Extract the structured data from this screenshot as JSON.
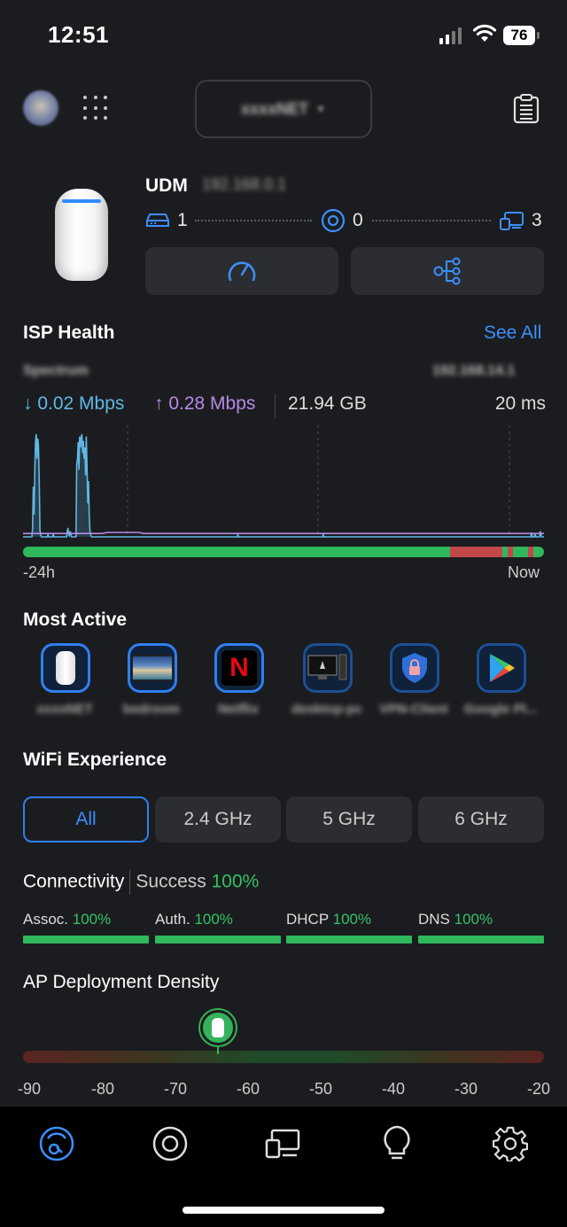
{
  "status_bar": {
    "time": "12:51",
    "battery": "76"
  },
  "header": {
    "site_name": "xxxxNET",
    "avatar": "user-avatar"
  },
  "device": {
    "name": "UDM",
    "ip": "192.168.0.1",
    "wired_count": "1",
    "wireless_count": "0",
    "clients_count": "3"
  },
  "isp_health": {
    "title": "ISP Health",
    "see_all": "See All",
    "isp_name": "Spectrum",
    "isp_ip": "192.168.14.1",
    "download": "0.02 Mbps",
    "upload": "0.28 Mbps",
    "total": "21.94 GB",
    "latency": "20 ms",
    "range_start": "-24h",
    "range_end": "Now"
  },
  "chart_data": {
    "type": "area",
    "title": "",
    "x_labels": [
      "-24h",
      "Now"
    ],
    "series": [
      {
        "values": [
          0,
          0,
          0,
          0,
          0,
          0,
          0,
          0,
          0,
          0,
          0,
          0,
          0,
          8,
          45,
          20,
          60,
          85,
          92,
          70,
          88,
          82,
          50,
          6,
          2,
          0,
          0,
          0,
          0,
          0,
          0,
          0,
          0,
          0,
          2,
          0,
          0,
          0,
          0,
          0,
          0,
          3,
          0,
          0,
          0,
          0,
          0,
          0,
          0,
          0,
          0,
          0,
          0,
          0,
          0,
          0,
          0,
          0,
          0,
          0,
          4,
          8,
          2,
          1,
          5,
          3,
          0,
          0,
          0,
          0,
          0,
          0,
          0,
          65,
          70,
          85,
          60,
          90,
          80,
          88,
          92,
          75,
          86,
          70,
          80,
          55,
          90,
          60,
          30,
          50,
          20,
          5,
          2,
          0,
          0,
          0,
          0,
          0,
          0,
          0,
          0,
          0,
          0,
          0,
          0,
          0,
          0,
          0,
          0,
          0,
          0,
          0,
          0,
          0,
          0,
          0,
          0,
          0,
          0,
          0,
          0,
          0,
          0,
          0,
          0,
          0,
          0,
          0,
          0,
          0,
          0,
          0,
          0,
          0,
          0,
          0,
          0,
          0,
          0,
          0,
          0,
          0,
          0,
          0,
          0,
          0,
          0,
          0,
          0,
          0,
          0,
          0,
          0,
          0,
          0,
          0,
          0,
          0,
          0,
          0,
          0,
          0,
          0,
          0,
          0,
          0,
          0,
          0,
          0,
          0,
          0,
          0,
          0,
          0,
          0,
          0,
          0,
          0,
          0,
          0,
          0,
          0,
          0,
          0,
          0,
          0,
          0,
          0,
          0,
          0,
          0,
          0,
          0,
          0,
          0,
          0,
          0,
          0,
          0,
          0,
          0,
          0,
          0,
          0,
          0,
          0,
          0,
          0,
          0,
          0,
          0,
          0,
          0,
          0,
          0,
          0,
          0,
          0,
          0,
          0,
          0,
          0,
          0,
          0,
          0,
          0,
          0,
          0,
          0,
          0,
          0,
          0,
          0,
          0,
          0,
          0,
          0,
          0,
          0,
          0,
          0,
          0,
          0,
          0,
          0,
          0,
          0,
          0,
          0,
          0,
          0,
          0,
          0,
          0,
          0,
          0,
          0,
          0,
          0,
          0,
          0,
          0,
          0,
          0,
          0,
          0,
          0,
          0,
          0,
          0,
          0,
          0,
          0,
          0,
          0,
          0,
          0,
          0,
          0,
          0,
          0,
          0,
          0,
          0,
          0,
          0,
          0,
          0,
          0,
          0,
          0,
          0,
          2,
          0,
          0,
          0,
          0,
          0,
          0,
          0,
          0,
          0,
          0,
          0,
          0,
          0,
          0,
          0,
          0,
          0,
          0,
          0,
          0,
          0,
          0,
          0,
          0,
          0,
          0,
          0,
          0,
          0,
          0,
          0,
          0,
          0,
          0,
          0,
          0,
          0,
          0,
          0,
          0,
          0,
          0,
          0,
          0,
          0,
          0,
          0,
          0,
          0,
          0,
          0,
          0,
          0,
          0,
          0,
          0,
          0,
          0,
          0,
          0,
          0,
          0,
          0,
          0,
          0,
          0,
          0,
          0,
          0,
          0,
          0,
          0,
          0,
          0,
          0,
          0,
          0,
          0,
          0,
          0,
          0,
          0,
          0,
          0,
          0,
          0,
          0,
          0,
          0,
          0,
          0,
          0,
          0,
          0,
          0,
          0,
          0,
          0,
          0,
          0,
          0,
          0,
          0,
          0,
          0,
          0,
          0,
          0,
          0,
          0,
          0,
          0,
          0,
          0,
          0,
          2,
          0,
          0,
          0,
          0,
          0,
          0,
          0,
          0,
          0,
          0,
          0,
          0,
          0,
          0,
          0,
          0,
          0,
          0,
          0,
          0,
          0,
          0,
          0,
          0,
          0,
          0,
          0,
          0,
          0,
          0,
          0,
          0,
          0,
          0,
          0,
          0,
          0,
          0,
          0,
          0,
          0,
          0,
          0,
          0,
          0,
          0,
          0,
          0,
          0,
          0,
          0,
          0,
          0,
          0,
          0,
          0,
          0,
          0,
          0,
          0,
          0,
          0,
          0,
          0,
          0,
          0,
          0,
          0,
          0,
          0,
          0,
          0,
          0,
          0,
          0,
          0,
          0,
          0,
          0,
          0,
          0,
          0,
          0,
          0,
          0,
          0,
          0,
          0,
          0,
          0,
          0,
          0,
          0,
          0,
          0,
          0,
          0,
          0,
          0,
          0,
          0,
          0,
          0,
          0,
          0,
          0,
          0,
          0,
          0,
          0,
          0,
          0,
          0,
          0,
          0,
          0,
          0,
          0,
          0,
          0,
          0,
          0,
          0,
          0,
          0,
          0,
          0,
          0,
          0,
          0,
          0,
          0,
          0,
          0,
          0,
          0,
          0,
          0,
          0,
          0,
          0,
          0,
          0,
          0,
          0,
          0,
          0,
          0,
          0,
          0,
          0,
          0,
          0,
          0,
          0,
          0,
          0,
          0,
          0,
          0,
          0,
          0,
          0,
          0,
          0,
          0,
          0,
          0,
          0,
          0,
          0,
          0,
          0,
          0,
          0,
          0,
          0,
          0,
          0,
          0,
          0,
          0,
          0,
          0,
          0,
          0,
          0,
          0,
          0,
          0,
          0,
          0,
          0,
          0,
          0,
          0,
          0,
          0,
          0,
          0,
          0,
          0,
          0,
          0,
          0,
          0,
          0,
          0,
          0,
          0,
          0,
          0,
          0,
          0,
          0,
          0,
          0,
          0,
          0,
          0,
          0,
          0,
          0,
          0,
          0,
          0,
          0,
          0,
          0,
          0,
          0,
          0,
          0,
          0,
          0,
          0,
          0,
          0,
          0,
          0,
          0,
          0,
          0,
          0,
          0,
          0,
          0,
          0,
          0,
          0,
          0,
          0,
          0,
          0,
          0,
          0,
          0,
          0,
          0,
          0,
          0,
          0,
          0,
          0,
          0,
          0,
          0,
          0,
          0,
          0,
          0,
          0,
          0,
          0,
          0,
          0,
          0,
          0,
          0,
          0,
          0,
          0,
          4,
          0,
          0,
          0,
          0,
          3,
          0,
          0,
          0,
          0,
          0,
          0,
          5,
          2,
          0,
          0,
          0,
          0
        ],
        "color": "#5fb8e6"
      },
      {
        "values": [
          3,
          3,
          3,
          3,
          3,
          3,
          3,
          3,
          3,
          3,
          3,
          3,
          3,
          3,
          3,
          3,
          4,
          4,
          4,
          4,
          4,
          4,
          4,
          3,
          3,
          3,
          3,
          3,
          3,
          3,
          3,
          3,
          3,
          3,
          3,
          3,
          3,
          3,
          3,
          3,
          3,
          3,
          3,
          3,
          3,
          3,
          3,
          3,
          3,
          3,
          3,
          3,
          3,
          3,
          3,
          3,
          3,
          3,
          3,
          3,
          3,
          3,
          3,
          3,
          3,
          3,
          3,
          3,
          3,
          3,
          3,
          3,
          3,
          3,
          3,
          3,
          3,
          3,
          3,
          3,
          3,
          3,
          3,
          3,
          3,
          3,
          3,
          3,
          3,
          3,
          3,
          3,
          3,
          3,
          3,
          3,
          3,
          3,
          3,
          3
        ],
        "color": "#b78ae6"
      }
    ],
    "health_segments": [
      {
        "fraction": 0.82,
        "color": "#2fb85c"
      },
      {
        "fraction": 0.1,
        "color": "#c2474a"
      },
      {
        "fraction": 0.01,
        "color": "#2fb85c"
      },
      {
        "fraction": 0.01,
        "color": "#c2474a"
      },
      {
        "fraction": 0.03,
        "color": "#2fb85c"
      },
      {
        "fraction": 0.01,
        "color": "#c2474a"
      },
      {
        "fraction": 0.02,
        "color": "#2fb85c"
      }
    ]
  },
  "most_active": {
    "title": "Most Active",
    "apps": [
      {
        "name": "xxxxNET",
        "icon": "udm-device-icon"
      },
      {
        "name": "bedroom",
        "icon": "tv-screen-icon"
      },
      {
        "name": "Netflix",
        "icon": "netflix-icon"
      },
      {
        "name": "desktop-pc",
        "icon": "monitor-pc-icon"
      },
      {
        "name": "VPN-Client",
        "icon": "shield-lock-icon"
      },
      {
        "name": "Google Pl...",
        "icon": "google-play-icon"
      }
    ]
  },
  "wifi": {
    "title": "WiFi Experience",
    "bands": [
      "All",
      "2.4 GHz",
      "5 GHz",
      "6 GHz"
    ],
    "connectivity_label": "Connectivity",
    "success_label": "Success",
    "success_value": "100%",
    "metrics": [
      {
        "label": "Assoc.",
        "value": "100%"
      },
      {
        "label": "Auth.",
        "value": "100%"
      },
      {
        "label": "DHCP",
        "value": "100%"
      },
      {
        "label": "DNS",
        "value": "100%"
      }
    ]
  },
  "ap_density": {
    "title": "AP Deployment Density",
    "ticks": [
      "-90",
      "-80",
      "-70",
      "-60",
      "-50",
      "-40",
      "-30",
      "-20"
    ],
    "value": -64
  },
  "tabs": [
    {
      "name": "dashboard",
      "icon": "dashboard-gauge-icon",
      "active": true
    },
    {
      "name": "devices",
      "icon": "unifi-device-icon"
    },
    {
      "name": "clients",
      "icon": "clients-icon"
    },
    {
      "name": "insights",
      "icon": "lightbulb-icon"
    },
    {
      "name": "settings",
      "icon": "gear-icon"
    }
  ]
}
